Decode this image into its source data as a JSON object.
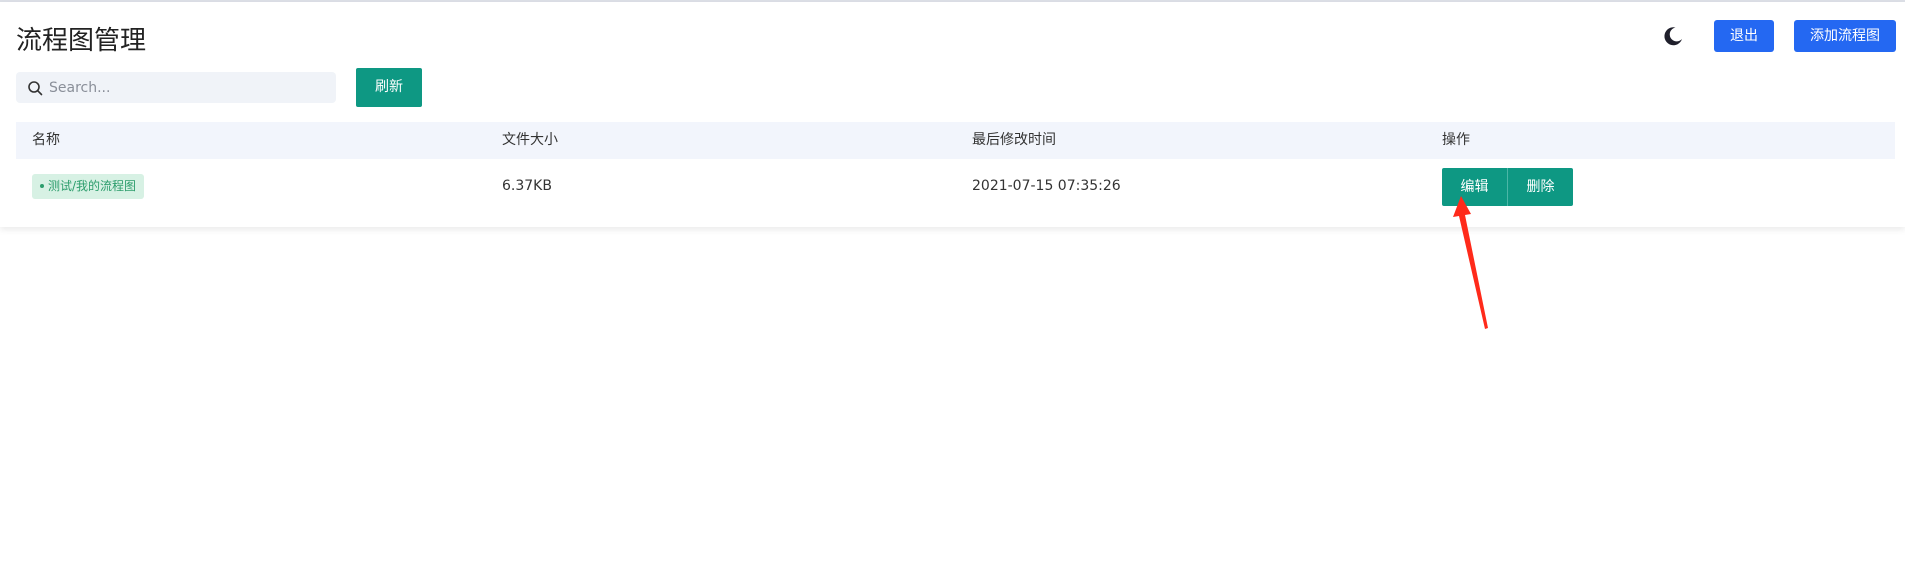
{
  "header": {
    "title": "流程图管理",
    "logout_label": "退出",
    "add_label": "添加流程图",
    "theme_icon": "moon-icon"
  },
  "toolbar": {
    "search_placeholder": "Search...",
    "search_value": "",
    "refresh_label": "刷新"
  },
  "table": {
    "columns": [
      "名称",
      "文件大小",
      "最后修改时间",
      "操作"
    ],
    "rows": [
      {
        "name": "测试/我的流程图",
        "size": "6.37KB",
        "modified": "2021-07-15 07:35:26",
        "actions": [
          "编辑",
          "删除"
        ]
      }
    ]
  },
  "colors": {
    "primary_blue": "#2468f2",
    "primary_green": "#0e9883",
    "tag_bg": "#d7f1e4",
    "tag_text": "#2c9d6c",
    "table_header_bg": "#f2f5fc",
    "annotation_arrow": "#ff2a1a"
  }
}
